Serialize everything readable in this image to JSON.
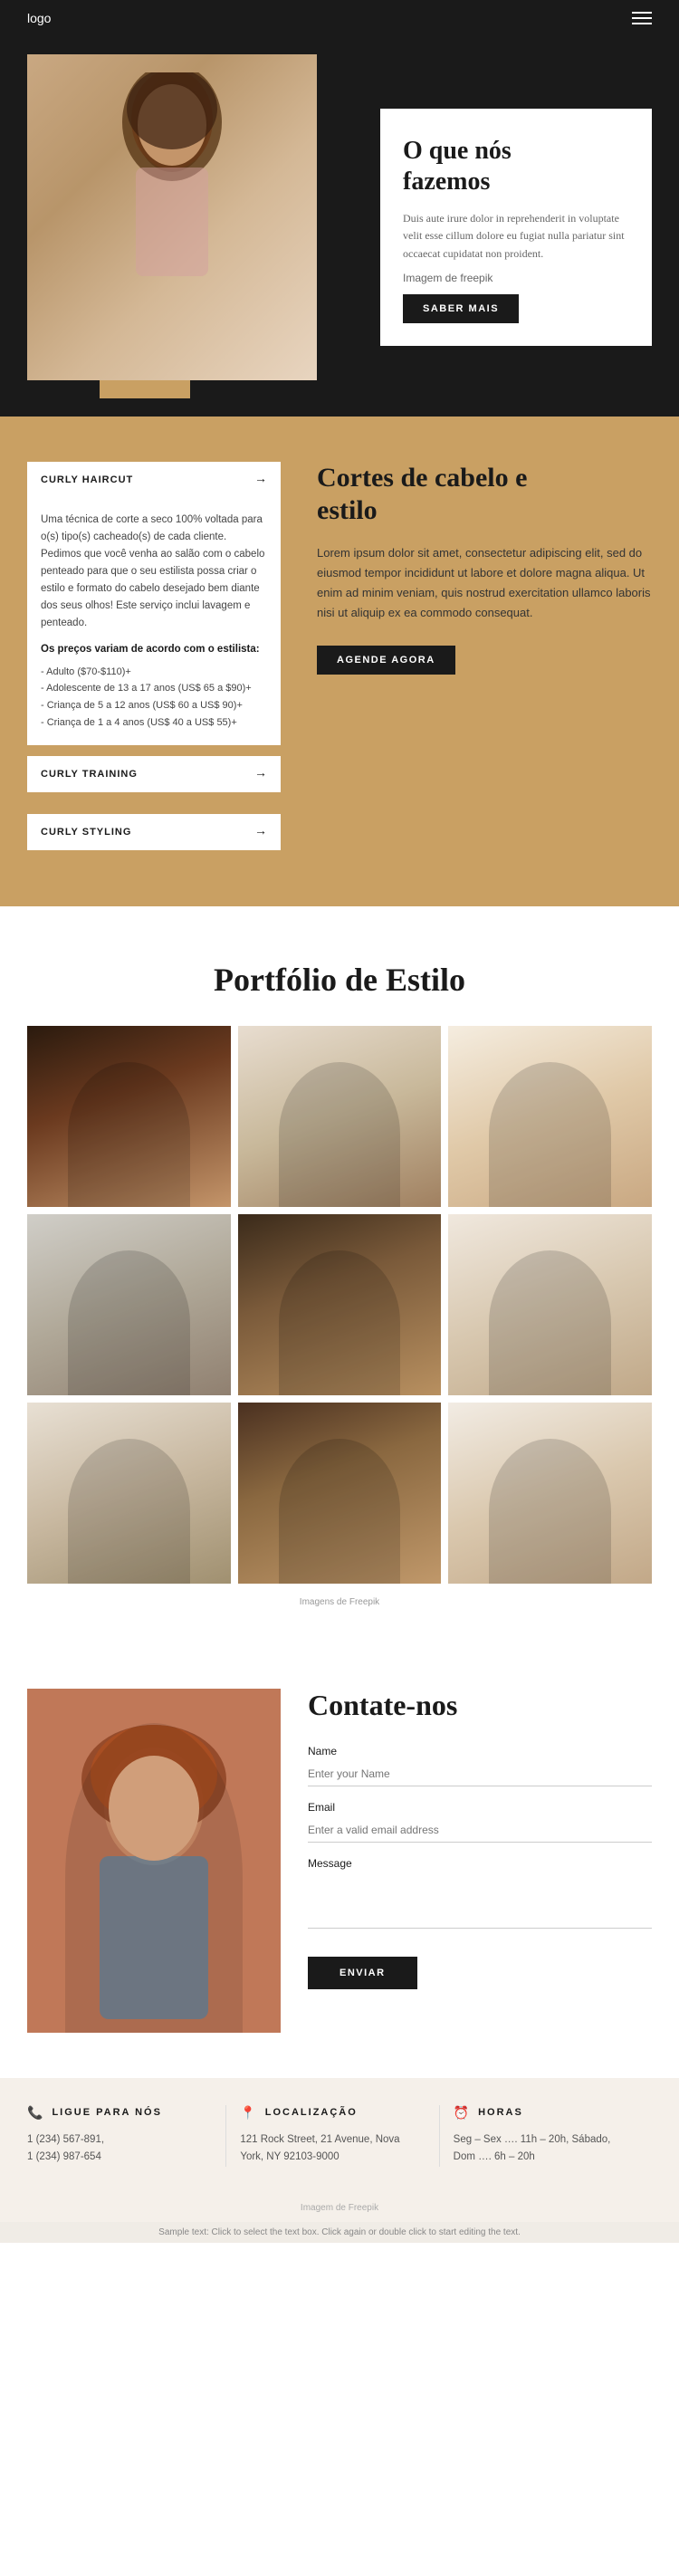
{
  "header": {
    "logo": "logo",
    "menu_icon": "☰"
  },
  "hero": {
    "title_line1": "O que nós",
    "title_line2": "fazemos",
    "body": "Duis aute irure dolor in reprehenderit in voluptate velit esse cillum dolore eu fugiat nulla pariatur sint occaecat cupidatat non proident.",
    "freepik_label": "Imagem de freepik",
    "cta_label": "SABER MAIS"
  },
  "services": {
    "title_line1": "Cortes de cabelo e",
    "title_line2": "estilo",
    "body": "Lorem ipsum dolor sit amet, consectetur adipiscing elit, sed do eiusmod tempor incididunt ut labore et dolore magna aliqua. Ut enim ad minim veniam, quis nostrud exercitation ullamco laboris nisi ut aliquip ex ea commodo consequat.",
    "cta_label": "AGENDE AGORA",
    "tab1": {
      "label": "CURLY HAIRCUT",
      "arrow": "→"
    },
    "tab2": {
      "label": "CURLY TRAINING",
      "arrow": "→"
    },
    "tab3": {
      "label": "CURLY STYLING",
      "arrow": "→"
    },
    "description": {
      "intro": "Uma técnica de corte a seco 100% voltada para o(s) tipo(s) cacheado(s) de cada cliente. Pedimos que você venha ao salão com o cabelo penteado para que o seu estilista possa criar o estilo e formato do cabelo desejado bem diante dos seus olhos! Este serviço inclui lavagem e penteado.",
      "price_label": "Os preços variam de acordo com o estilista:",
      "prices": [
        "- Adulto ($70-$110)+",
        "- Adolescente de 13 a 17 anos (US$ 65 a $90)+",
        "- Criança de 5 a 12 anos (US$ 60 a US$ 90)+",
        "- Criança de 1 a 4 anos (US$ 40 a US$ 55)+"
      ]
    }
  },
  "portfolio": {
    "title": "Portfólio de Estilo",
    "freepik_label": "Imagens de Freepik",
    "photos": [
      {
        "id": "ph1",
        "alt": "Person with curly hair 1"
      },
      {
        "id": "ph2",
        "alt": "Person with curly hair 2"
      },
      {
        "id": "ph3",
        "alt": "Person with curly hair 3"
      },
      {
        "id": "ph4",
        "alt": "Person with curly hair 4"
      },
      {
        "id": "ph5",
        "alt": "Person with curly hair 5"
      },
      {
        "id": "ph6",
        "alt": "Person with curly hair 6"
      },
      {
        "id": "ph7",
        "alt": "Person with curly hair 7"
      },
      {
        "id": "ph8",
        "alt": "Person with curly hair 8"
      },
      {
        "id": "ph9",
        "alt": "Person with curly hair 9"
      }
    ]
  },
  "contact": {
    "title": "Contate-nos",
    "name_label": "Name",
    "name_placeholder": "Enter your Name",
    "email_label": "Email",
    "email_placeholder": "Enter a valid email address",
    "message_label": "Message",
    "send_label": "ENVIAR"
  },
  "footer": {
    "col1": {
      "icon": "📞",
      "title": "LIGUE PARA NÓS",
      "line1": "1 (234) 567-891,",
      "line2": "1 (234) 987-654"
    },
    "col2": {
      "icon": "📍",
      "title": "LOCALIZAÇÃO",
      "line1": "121 Rock Street, 21 Avenue, Nova",
      "line2": "York, NY 92103-9000"
    },
    "col3": {
      "icon": "⏰",
      "title": "HORAS",
      "line1": "Seg – Sex …. 11h – 20h, Sábado,",
      "line2": "Dom …. 6h – 20h"
    },
    "freepik_label": "Imagem de Freepik"
  },
  "watermark": {
    "text": "Sample text: Click to select the text box. Click again or double click to start editing the text."
  }
}
